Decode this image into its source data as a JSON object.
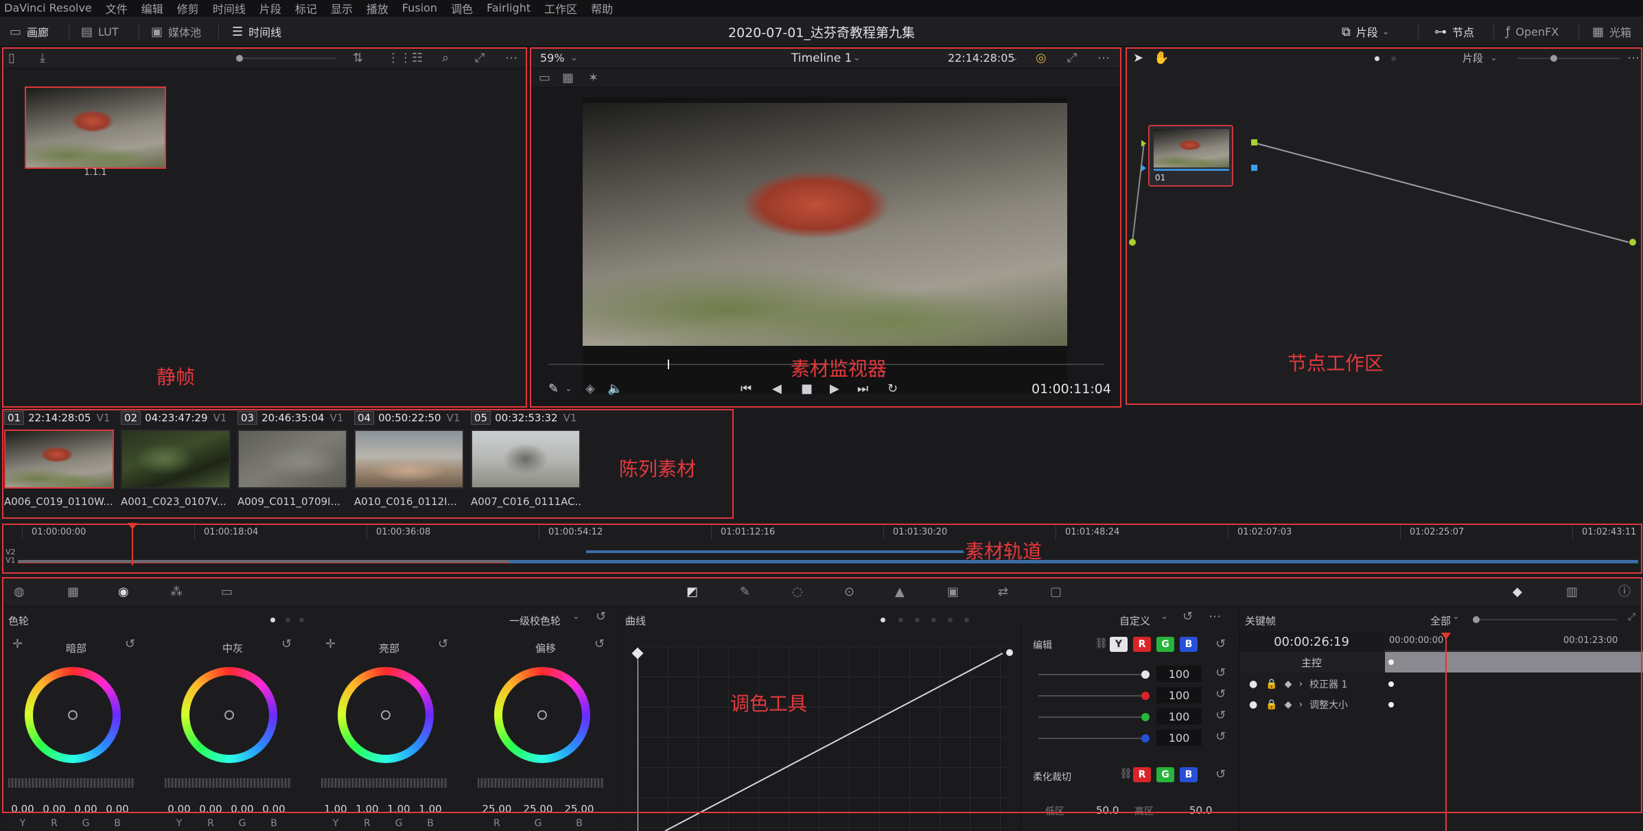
{
  "menu": [
    "DaVinci Resolve",
    "文件",
    "编辑",
    "修剪",
    "时间线",
    "片段",
    "标记",
    "显示",
    "播放",
    "Fusion",
    "调色",
    "Fairlight",
    "工作区",
    "帮助"
  ],
  "toolbar": {
    "gallery": "画廊",
    "lut": "LUT",
    "media_pool": "媒体池",
    "timeline": "时间线",
    "project_title": "2020-07-01_达芬奇教程第九集",
    "clips": "片段",
    "nodes": "节点",
    "openfx": "OpenFX",
    "lightbox": "光箱"
  },
  "viewer": {
    "zoom": "59%",
    "timeline_name": "Timeline 1",
    "source_tc": "22:14:28:05",
    "record_tc": "01:00:11:04"
  },
  "gallery": {
    "still_label": "1.1.1"
  },
  "node_editor": {
    "mode": "片段",
    "node_label": "01"
  },
  "clips": [
    {
      "num": "01",
      "tc": "22:14:28:05",
      "track": "V1",
      "name": "A006_C019_0110W..."
    },
    {
      "num": "02",
      "tc": "04:23:47:29",
      "track": "V1",
      "name": "A001_C023_0107V..."
    },
    {
      "num": "03",
      "tc": "20:46:35:04",
      "track": "V1",
      "name": "A009_C011_0709I..."
    },
    {
      "num": "04",
      "tc": "00:50:22:50",
      "track": "V1",
      "name": "A010_C016_0112I..."
    },
    {
      "num": "05",
      "tc": "00:32:53:32",
      "track": "V1",
      "name": "A007_C016_0111AC..."
    }
  ],
  "mini_timeline": {
    "ticks": [
      "01:00:00:00",
      "01:00:18:04",
      "01:00:36:08",
      "01:00:54:12",
      "01:01:12:16",
      "01:01:30:20",
      "01:01:48:24",
      "01:02:07:03",
      "01:02:25:07",
      "01:02:43:11"
    ],
    "tracks": [
      "V2",
      "V1"
    ]
  },
  "color_wheels": {
    "title": "色轮",
    "mode": "一级校色轮",
    "wheels": [
      {
        "name": "暗部",
        "values": [
          "0.00",
          "0.00",
          "0.00",
          "0.00"
        ],
        "channels": [
          "Y",
          "R",
          "G",
          "B"
        ]
      },
      {
        "name": "中灰",
        "values": [
          "0.00",
          "0.00",
          "0.00",
          "0.00"
        ],
        "channels": [
          "Y",
          "R",
          "G",
          "B"
        ]
      },
      {
        "name": "亮部",
        "values": [
          "1.00",
          "1.00",
          "1.00",
          "1.00"
        ],
        "channels": [
          "Y",
          "R",
          "G",
          "B"
        ]
      },
      {
        "name": "偏移",
        "values": [
          "25.00",
          "25.00",
          "25.00"
        ],
        "channels": [
          "R",
          "G",
          "B"
        ]
      }
    ]
  },
  "curves": {
    "title": "曲线",
    "preset": "自定义",
    "edit": "编辑",
    "soft_clip": "柔化裁切",
    "edit_values": [
      "100",
      "100",
      "100",
      "100"
    ],
    "low_label": "低区",
    "low_value": "50.0",
    "high_label": "高区",
    "high_value": "50.0",
    "y_btn": "Y",
    "r_btn": "R",
    "g_btn": "G",
    "b_btn": "B"
  },
  "keyframes": {
    "title": "关键帧",
    "filter": "全部",
    "timecode": "00:00:26:19",
    "ruler": [
      "00:00:00:00",
      "00:01:23:00"
    ],
    "rows": [
      "主控",
      "校正器 1",
      "调整大小"
    ]
  },
  "annotations": {
    "gallery": "静帧",
    "viewer": "素材监视器",
    "nodes": "节点工作区",
    "clips": "陈列素材",
    "timeline": "素材轨道",
    "color": "调色工具"
  },
  "colors": {
    "accent_red": "#e1373a",
    "playhead": "#e2392f",
    "clip_blue": "#3a6ea5"
  }
}
